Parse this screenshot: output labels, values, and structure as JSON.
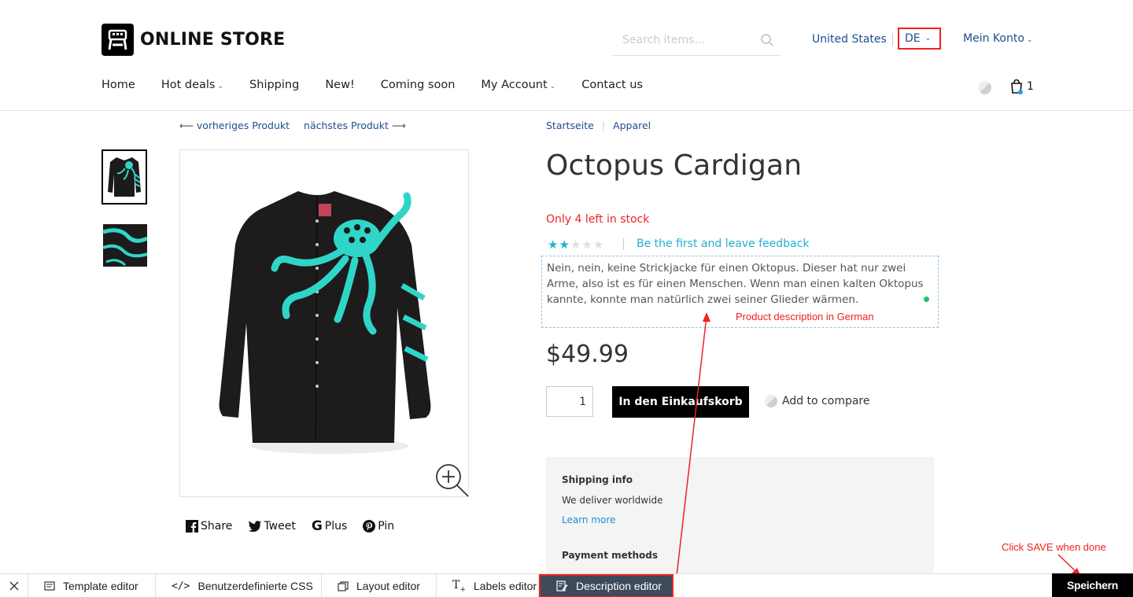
{
  "header": {
    "logo_text": "ONLINE STORE",
    "search_placeholder": "Search items...",
    "country": "United States",
    "language": "DE",
    "account": "Mein Konto",
    "cart_count": "1"
  },
  "nav": {
    "items": [
      "Home",
      "Hot deals",
      "Shipping",
      "New!",
      "Coming soon",
      "My Account",
      "Contact us"
    ]
  },
  "product_nav": {
    "prev": "vorheriges Produkt",
    "next": "nächstes Produkt"
  },
  "breadcrumb": [
    "Startseite",
    "Apparel"
  ],
  "product": {
    "title": "Octopus Cardigan",
    "stock": "Only 4 left in stock",
    "rating": 2,
    "rating_max": 5,
    "review_link": "Be the first and leave feedback",
    "description": "Nein, nein, keine Strickjacke für einen Oktopus. Dieser hat nur zwei Arme, also ist es für einen Menschen. Wenn man einen kalten Oktopus kannte, konnte man natürlich zwei seiner Glieder wärmen.",
    "price": "$49.99",
    "quantity": "1",
    "add_to_cart": "In den Einkaufskorb",
    "add_to_compare": "Add to compare"
  },
  "share": {
    "facebook": "Share",
    "twitter": "Tweet",
    "google": "Plus",
    "pinterest": "Pin"
  },
  "info": {
    "shipping_title": "Shipping info",
    "shipping_text": "We deliver worldwide",
    "learn_more": "Learn more",
    "payment_title": "Payment methods"
  },
  "annotations": {
    "description_note": "Product description in German",
    "save_note": "Click SAVE when done"
  },
  "toolbar": {
    "items": [
      "Template editor",
      "Benutzerdefinierte CSS",
      "Layout editor",
      "Labels editor",
      "Description editor"
    ],
    "save": "Speichern"
  },
  "colors": {
    "accent_link": "#1f4e8c",
    "rating_star": "#1fb0d4",
    "stock_red": "#e22222",
    "toolbar_active": "#3e4a5a",
    "teal_print": "#2fd6c8"
  }
}
